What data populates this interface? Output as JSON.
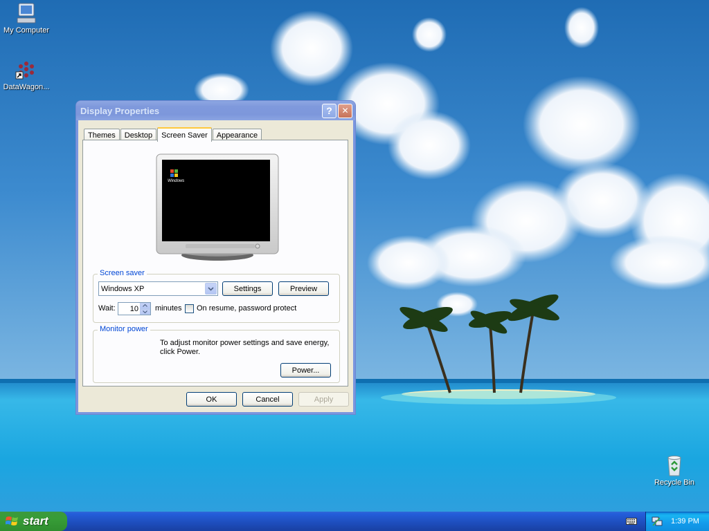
{
  "desktop": {
    "icons": [
      {
        "label": "My Computer",
        "icon": "my-computer-icon"
      },
      {
        "label": "DataWagon...",
        "icon": "datawagon-icon"
      },
      {
        "label": "Recycle Bin",
        "icon": "recycle-bin-icon"
      }
    ]
  },
  "window": {
    "title": "Display Properties",
    "help_glyph": "?",
    "close_glyph": "✕",
    "tabs": [
      {
        "label": "Themes"
      },
      {
        "label": "Desktop"
      },
      {
        "label": "Screen Saver",
        "active": true
      },
      {
        "label": "Appearance"
      }
    ],
    "preview_logo_text": "Windows",
    "screen_saver": {
      "group_label": "Screen saver",
      "selected": "Windows XP",
      "settings_label": "Settings",
      "preview_label": "Preview",
      "wait_label": "Wait:",
      "wait_value": "10",
      "minutes_label": "minutes",
      "password_label": "On resume, password protect",
      "password_checked": false
    },
    "monitor_power": {
      "group_label": "Monitor power",
      "description": "To adjust monitor power settings and save energy, click Power.",
      "power_label": "Power..."
    },
    "buttons": {
      "ok": "OK",
      "cancel": "Cancel",
      "apply": "Apply"
    }
  },
  "taskbar": {
    "start_label": "start",
    "clock": "1:39 PM"
  }
}
